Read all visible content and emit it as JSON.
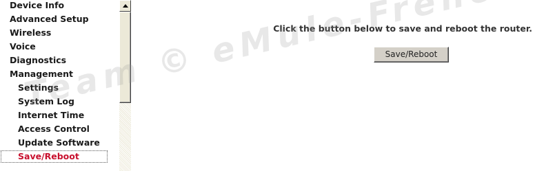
{
  "sidebar": {
    "items": [
      {
        "label": "Device Info"
      },
      {
        "label": "Advanced Setup"
      },
      {
        "label": "Wireless"
      },
      {
        "label": "Voice"
      },
      {
        "label": "Diagnostics"
      },
      {
        "label": "Management"
      }
    ],
    "management_subitems": [
      {
        "label": "Settings"
      },
      {
        "label": "System Log"
      },
      {
        "label": "Internet Time"
      },
      {
        "label": "Access Control"
      },
      {
        "label": "Update Software"
      },
      {
        "label": "Save/Reboot",
        "active": true
      }
    ],
    "scroll_up_icon": "triangle-up"
  },
  "main": {
    "instruction": "Click the button below to save and reboot the router.",
    "save_button_label": "Save/Reboot"
  },
  "watermark": {
    "text": "Team © eMule-French"
  },
  "colors": {
    "active_item": "#c8102e",
    "text": "#1a1a1a",
    "button_face": "#d4d0c8",
    "scrollbar_track": "#ece9d8"
  }
}
